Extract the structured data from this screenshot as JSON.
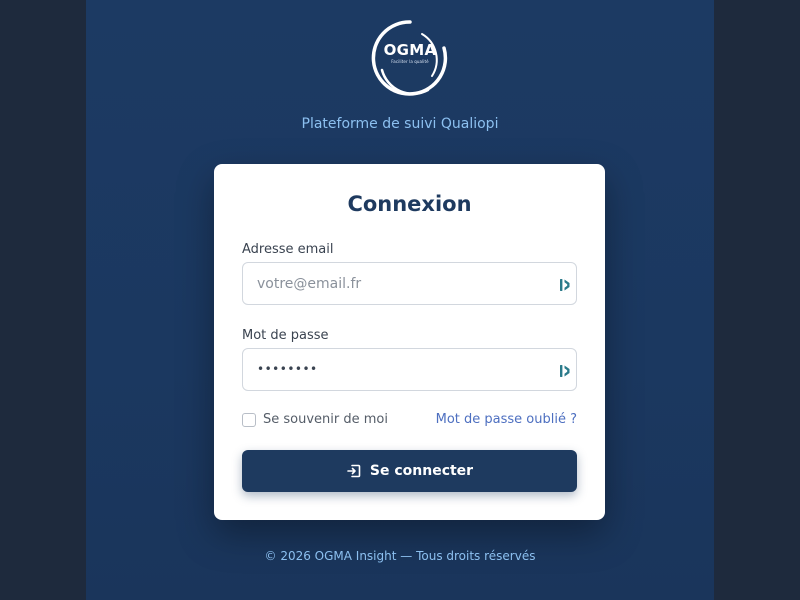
{
  "brand": {
    "logo_text": "OGMA",
    "logo_tagline": "Faciliter la qualité",
    "subtitle": "Plateforme de suivi Qualiopi"
  },
  "login_card": {
    "title": "Connexion",
    "email": {
      "label": "Adresse email",
      "placeholder": "votre@email.fr",
      "value": ""
    },
    "password": {
      "label": "Mot de passe",
      "masked_value": "••••••••"
    },
    "remember_me": {
      "label": "Se souvenir de moi",
      "checked": false
    },
    "forgot_password": "Mot de passe oublié ?",
    "submit": {
      "label": "Se connecter",
      "icon": "login-icon"
    },
    "field_icon": "password-manager-icon"
  },
  "footer": {
    "copyright": "© 2026 OGMA Insight — Tous droits réservés"
  },
  "colors": {
    "background": "#1e2a3d",
    "stage": "#1c3a63",
    "primary": "#1e3a5f",
    "accent_text": "#8cc0f0",
    "link": "#4d6fc0",
    "field_icon": "#2a7a8a"
  }
}
